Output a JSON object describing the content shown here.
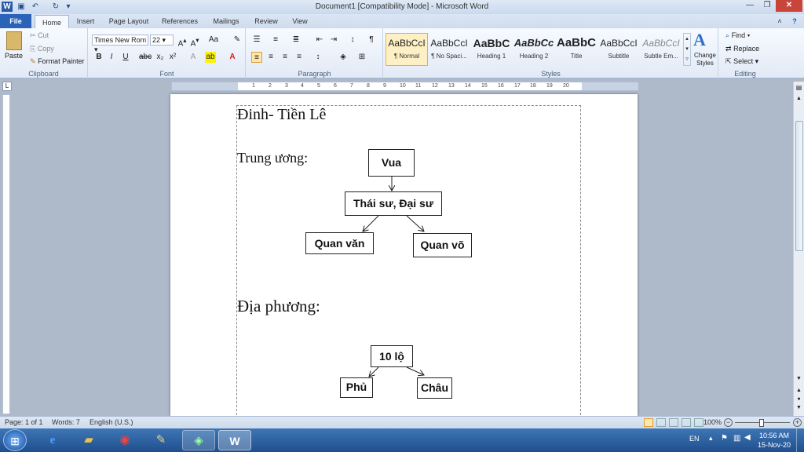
{
  "window": {
    "title": "Document1 [Compatibility Mode] - Microsoft Word"
  },
  "tabs": [
    "File",
    "Home",
    "Insert",
    "Page Layout",
    "References",
    "Mailings",
    "Review",
    "View"
  ],
  "clipboard": {
    "paste": "Paste",
    "cut": "Cut",
    "copy": "Copy",
    "format_painter": "Format Painter",
    "label": "Clipboard"
  },
  "font": {
    "name": "Times New Rom",
    "size": "22",
    "label": "Font"
  },
  "paragraph": {
    "label": "Paragraph"
  },
  "styles": {
    "label": "Styles",
    "items": [
      {
        "sample": "AaBbCcI",
        "name": "¶ Normal"
      },
      {
        "sample": "AaBbCcI",
        "name": "¶ No Spaci..."
      },
      {
        "sample": "AaBbC",
        "name": "Heading 1"
      },
      {
        "sample": "AaBbCc",
        "name": "Heading 2"
      },
      {
        "sample": "AaBbC",
        "name": "Title"
      },
      {
        "sample": "AaBbCcI",
        "name": "Subtitle"
      },
      {
        "sample": "AaBbCcI",
        "name": "Subtle Em..."
      }
    ],
    "change_styles": "Change Styles"
  },
  "editing": {
    "find": "Find",
    "replace": "Replace",
    "select": "Select",
    "label": "Editing"
  },
  "ruler": {
    "numbers": [
      "1",
      "2",
      "3",
      "4",
      "5",
      "6",
      "7",
      "8",
      "9",
      "10",
      "11",
      "12",
      "13",
      "14",
      "15",
      "16",
      "17",
      "18",
      "19",
      "20"
    ]
  },
  "document": {
    "heading": "Đinh- Tiền Lê",
    "central_label": "Trung ương:",
    "central_boxes": {
      "king": "Vua",
      "advisors": "Thái sư, Đại sư",
      "civil": "Quan văn",
      "military": "Quan võ"
    },
    "local_label": "Địa phương:",
    "local_boxes": {
      "provinces": "10 lộ",
      "phu": "Phủ",
      "chau": "Châu"
    }
  },
  "status": {
    "page": "Page: 1 of 1",
    "words": "Words: 7",
    "language": "English (U.S.)",
    "zoom": "100%"
  },
  "tray": {
    "lang": "EN",
    "time": "10:56 AM",
    "date": "15-Nov-20"
  }
}
